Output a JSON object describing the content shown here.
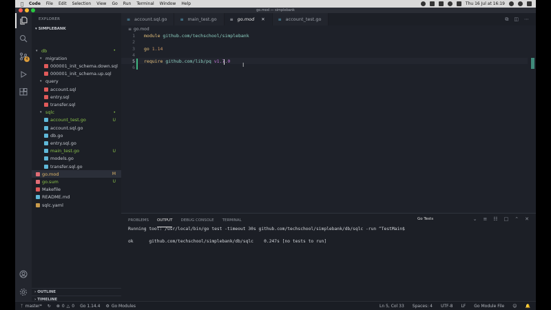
{
  "menubar": {
    "app": "Code",
    "items": [
      "File",
      "Edit",
      "Selection",
      "View",
      "Go",
      "Run",
      "Terminal",
      "Window",
      "Help"
    ],
    "clock": "Thu 16 Jul at 16:19"
  },
  "window": {
    "title": "go.mod — simplebank"
  },
  "activity": {
    "scm_badge": "4"
  },
  "sidebar": {
    "header": "EXPLORER",
    "project": "SIMPLEBANK",
    "tree": [
      {
        "label": "db",
        "type": "folder",
        "status": "•",
        "color": "#8bc34a"
      },
      {
        "label": "migration",
        "type": "folder",
        "status": ""
      },
      {
        "label": "000001_init_schema.down.sql",
        "type": "sql",
        "status": ""
      },
      {
        "label": "000001_init_schema.up.sql",
        "type": "sql",
        "status": ""
      },
      {
        "label": "query",
        "type": "folder",
        "status": ""
      },
      {
        "label": "account.sql",
        "type": "sql",
        "status": ""
      },
      {
        "label": "entry.sql",
        "type": "sql",
        "status": ""
      },
      {
        "label": "transfer.sql",
        "type": "sql",
        "status": ""
      },
      {
        "label": "sqlc",
        "type": "folder",
        "status": "•",
        "color": "#8bc34a"
      },
      {
        "label": "account_test.go",
        "type": "go",
        "status": "U",
        "color": "#8bc34a"
      },
      {
        "label": "account.sql.go",
        "type": "go",
        "status": ""
      },
      {
        "label": "db.go",
        "type": "go",
        "status": ""
      },
      {
        "label": "entry.sql.go",
        "type": "go",
        "status": ""
      },
      {
        "label": "main_test.go",
        "type": "go",
        "status": "U",
        "color": "#8bc34a"
      },
      {
        "label": "models.go",
        "type": "go",
        "status": ""
      },
      {
        "label": "transfer.sql.go",
        "type": "go",
        "status": ""
      },
      {
        "label": "go.mod",
        "type": "mod",
        "status": "M",
        "color": "#e2b86b"
      },
      {
        "label": "go.sum",
        "type": "sum",
        "status": "U",
        "color": "#8bc34a"
      },
      {
        "label": "Makefile",
        "type": "make",
        "status": ""
      },
      {
        "label": "README.md",
        "type": "md",
        "status": ""
      },
      {
        "label": "sqlc.yaml",
        "type": "yaml",
        "status": ""
      }
    ],
    "outline": "OUTLINE",
    "timeline": "TIMELINE"
  },
  "tabs": [
    {
      "label": "account.sql.go",
      "active": false
    },
    {
      "label": "main_test.go",
      "active": false
    },
    {
      "label": "go.mod",
      "active": true
    },
    {
      "label": "account_test.go",
      "active": false
    }
  ],
  "editor": {
    "breadcrumb": "go.mod",
    "lines": [
      {
        "n": "1",
        "kw": "module",
        "rest": " github.com/techschool/simplebank"
      },
      {
        "n": "2",
        "kw": "",
        "rest": ""
      },
      {
        "n": "3",
        "kw": "go",
        "rest": " 1.14"
      },
      {
        "n": "4",
        "kw": "",
        "rest": ""
      },
      {
        "n": "5",
        "kw": "require",
        "rest": " github.com/lib/pq",
        "ver": " v1.7.0"
      },
      {
        "n": "6",
        "kw": "",
        "rest": ""
      }
    ]
  },
  "panel": {
    "tabs": [
      "PROBLEMS",
      "OUTPUT",
      "DEBUG CONSOLE",
      "TERMINAL"
    ],
    "active_tab": "OUTPUT",
    "channel": "Go Tests",
    "output": [
      "Running tool: /usr/local/bin/go test -timeout 30s github.com/techschool/simplebank/db/sqlc -run ^TestMain$",
      "ok      github.com/techschool/simplebank/db/sqlc    0.247s [no tests to run]"
    ]
  },
  "statusbar": {
    "branch": "master*",
    "errors": "0",
    "warnings": "0",
    "go_version": "Go 1.14.4",
    "go_modules": "Go Modules",
    "position": "Ln 5, Col 33",
    "spaces": "Spaces: 4",
    "encoding": "UTF-8",
    "eol": "LF",
    "language": "Go Module File"
  },
  "colors": {
    "added": "#8bc34a",
    "modified": "#e2b86b",
    "accent_badge": "#d89a3b"
  }
}
